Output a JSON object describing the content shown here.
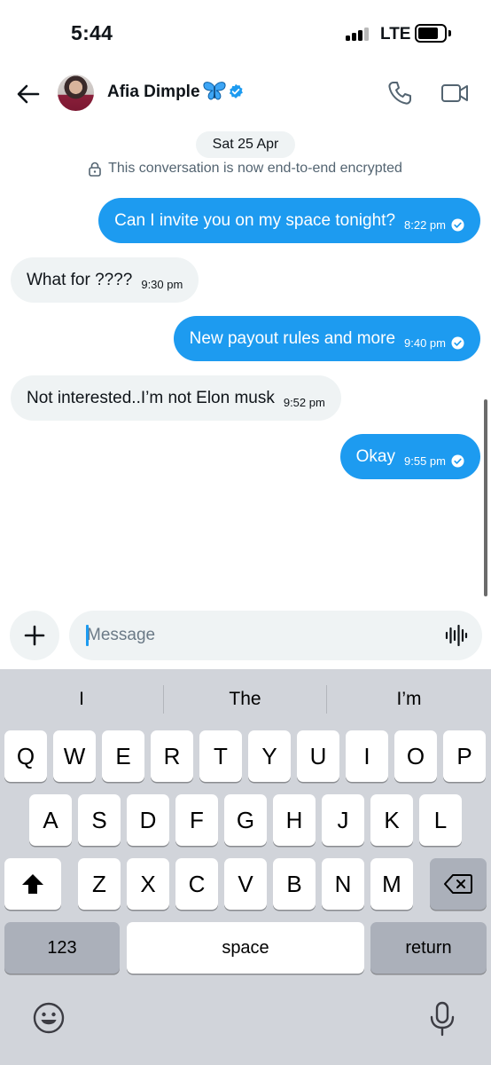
{
  "status_bar": {
    "time": "5:44",
    "network": "LTE"
  },
  "header": {
    "contact_name": "Afia Dimple",
    "name_emoji": "blue-butterfly",
    "verified": true
  },
  "chat": {
    "date": "Sat 25 Apr",
    "encryption_notice": "This conversation is now end-to-end encrypted",
    "messages": [
      {
        "direction": "out",
        "text": "Can I invite you on my space tonight?",
        "time": "8:22 pm",
        "read": true
      },
      {
        "direction": "in",
        "text": "What for ????",
        "time": "9:30 pm"
      },
      {
        "direction": "out",
        "text": "New payout rules and more",
        "time": "9:40 pm",
        "read": true
      },
      {
        "direction": "in",
        "text": "Not interested..I’m not Elon musk",
        "time": "9:52 pm"
      },
      {
        "direction": "out",
        "text": "Okay",
        "time": "9:55 pm",
        "read": true
      }
    ]
  },
  "composer": {
    "placeholder": "Message"
  },
  "keyboard": {
    "suggestions": [
      "I",
      "The",
      "I’m"
    ],
    "row1": [
      "Q",
      "W",
      "E",
      "R",
      "T",
      "Y",
      "U",
      "I",
      "O",
      "P"
    ],
    "row2": [
      "A",
      "S",
      "D",
      "F",
      "G",
      "H",
      "J",
      "K",
      "L"
    ],
    "row3": [
      "Z",
      "X",
      "C",
      "V",
      "B",
      "N",
      "M"
    ],
    "numbers_key": "123",
    "space_key": "space",
    "return_key": "return"
  },
  "colors": {
    "accent": "#1d9bf0",
    "incoming_bubble": "#eff3f4",
    "keyboard_bg": "#d1d4da"
  },
  "icons": {
    "back": "arrow-left-icon",
    "call": "phone-icon",
    "video": "video-camera-icon",
    "lock": "lock-icon",
    "check": "check-circle-icon",
    "plus": "plus-icon",
    "voice": "waveform-icon",
    "shift": "shift-icon",
    "delete": "backspace-icon",
    "emoji": "emoji-icon",
    "dictation": "microphone-icon"
  }
}
